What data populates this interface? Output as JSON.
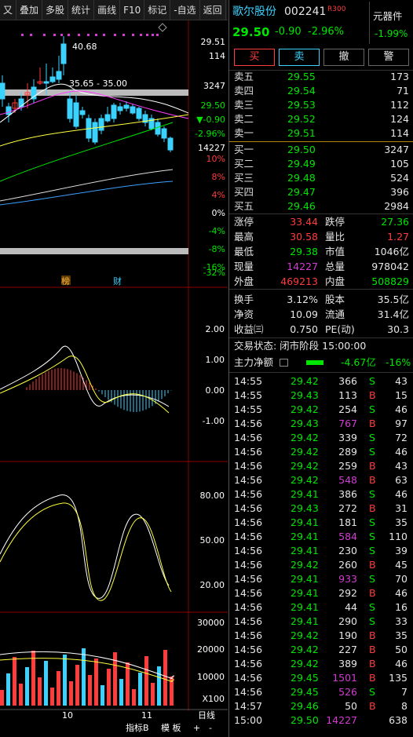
{
  "toolbar": {
    "items": [
      "又",
      "叠加",
      "多股",
      "统计",
      "画线",
      "F10",
      "标记",
      "-自选",
      "返回"
    ]
  },
  "stock": {
    "name": "歌尔股份",
    "code": "002241",
    "tag": "R300",
    "price": "29.50",
    "change": "-0.90",
    "change_pct": "-2.96%",
    "sector_name": "元器件",
    "sector_pct": "-1.99%"
  },
  "actions": {
    "buy": "买",
    "sell": "卖",
    "cancel": "撤",
    "alert": "警"
  },
  "asks": [
    {
      "label": "卖五",
      "price": "29.55",
      "vol": "173"
    },
    {
      "label": "卖四",
      "price": "29.54",
      "vol": "71"
    },
    {
      "label": "卖三",
      "price": "29.53",
      "vol": "112"
    },
    {
      "label": "卖二",
      "price": "29.52",
      "vol": "124"
    },
    {
      "label": "卖一",
      "price": "29.51",
      "vol": "114"
    }
  ],
  "bids": [
    {
      "label": "买一",
      "price": "29.50",
      "vol": "3247"
    },
    {
      "label": "买二",
      "price": "29.49",
      "vol": "105"
    },
    {
      "label": "买三",
      "price": "29.48",
      "vol": "524"
    },
    {
      "label": "买四",
      "price": "29.47",
      "vol": "396"
    },
    {
      "label": "买五",
      "price": "29.46",
      "vol": "2984"
    }
  ],
  "stats": {
    "limit_up_label": "涨停",
    "limit_up": "33.44",
    "limit_down_label": "跌停",
    "limit_down": "27.36",
    "high_label": "最高",
    "high": "30.58",
    "vol_ratio_label": "量比",
    "vol_ratio": "1.27",
    "low_label": "最低",
    "low": "29.38",
    "mcap_label": "市值",
    "mcap": "1046亿",
    "cur_vol_label": "现量",
    "cur_vol": "14227",
    "total_vol_label": "总量",
    "total_vol": "978042",
    "outer_label": "外盘",
    "outer": "469213",
    "inner_label": "内盘",
    "inner": "508829",
    "turnover_label": "换手",
    "turnover": "3.12%",
    "shares_label": "股本",
    "shares": "35.5亿",
    "nav_label": "净资",
    "nav": "10.09",
    "float_label": "流通",
    "float": "31.4亿",
    "eps_label": "收益㈢",
    "eps": "0.750",
    "pe_label": "PE(动)",
    "pe": "30.3"
  },
  "trade_status": "交易状态: 闭市阶段 15:00:00",
  "main_flow": {
    "label": "主力净额",
    "value": "-4.67亿",
    "pct": "-16%"
  },
  "ticks": [
    {
      "t": "14:55",
      "p": "29.42",
      "v": "366",
      "s": "S",
      "n": "43"
    },
    {
      "t": "14:55",
      "p": "29.43",
      "v": "113",
      "s": "B",
      "n": "15"
    },
    {
      "t": "14:55",
      "p": "29.42",
      "v": "254",
      "s": "S",
      "n": "46"
    },
    {
      "t": "14:56",
      "p": "29.43",
      "v": "767",
      "s": "B",
      "n": "97"
    },
    {
      "t": "14:56",
      "p": "29.42",
      "v": "339",
      "s": "S",
      "n": "72"
    },
    {
      "t": "14:56",
      "p": "29.42",
      "v": "289",
      "s": "S",
      "n": "46"
    },
    {
      "t": "14:56",
      "p": "29.42",
      "v": "259",
      "s": "B",
      "n": "43"
    },
    {
      "t": "14:56",
      "p": "29.42",
      "v": "548",
      "s": "B",
      "n": "63"
    },
    {
      "t": "14:56",
      "p": "29.41",
      "v": "386",
      "s": "S",
      "n": "46"
    },
    {
      "t": "14:56",
      "p": "29.43",
      "v": "272",
      "s": "B",
      "n": "31"
    },
    {
      "t": "14:56",
      "p": "29.41",
      "v": "181",
      "s": "S",
      "n": "35"
    },
    {
      "t": "14:56",
      "p": "29.41",
      "v": "584",
      "s": "S",
      "n": "110"
    },
    {
      "t": "14:56",
      "p": "29.41",
      "v": "230",
      "s": "S",
      "n": "39"
    },
    {
      "t": "14:56",
      "p": "29.42",
      "v": "260",
      "s": "B",
      "n": "45"
    },
    {
      "t": "14:56",
      "p": "29.41",
      "v": "933",
      "s": "S",
      "n": "70"
    },
    {
      "t": "14:56",
      "p": "29.41",
      "v": "292",
      "s": "B",
      "n": "46"
    },
    {
      "t": "14:56",
      "p": "29.41",
      "v": "44",
      "s": "S",
      "n": "16"
    },
    {
      "t": "14:56",
      "p": "29.41",
      "v": "290",
      "s": "S",
      "n": "33"
    },
    {
      "t": "14:56",
      "p": "29.42",
      "v": "190",
      "s": "B",
      "n": "35"
    },
    {
      "t": "14:56",
      "p": "29.42",
      "v": "227",
      "s": "B",
      "n": "50"
    },
    {
      "t": "14:56",
      "p": "29.42",
      "v": "389",
      "s": "B",
      "n": "46"
    },
    {
      "t": "14:56",
      "p": "29.45",
      "v": "1501",
      "s": "B",
      "n": "135"
    },
    {
      "t": "14:56",
      "p": "29.45",
      "v": "526",
      "s": "S",
      "n": "7"
    },
    {
      "t": "14:57",
      "p": "29.46",
      "v": "50",
      "s": "B",
      "n": "8"
    },
    {
      "t": "15:00",
      "p": "29.50",
      "v": "14227",
      "s": "",
      "n": "638"
    }
  ],
  "chart": {
    "price_axis": [
      "29.51",
      "114",
      "3247",
      "29.50",
      "▼-0.90",
      "-2.96%",
      "14227",
      "10%",
      "8%",
      "4%",
      "0%",
      "-4%",
      "-8%",
      "-16%",
      "-24%",
      "-32%"
    ],
    "high_annot": "40.68",
    "range_annot": "35.65 - 35.00",
    "markers": [
      "榜",
      "财"
    ],
    "macd_axis": [
      "2.00",
      "1.00",
      "0.00",
      "-1.00"
    ],
    "kdj_axis": [
      "80.00",
      "50.00",
      "20.00"
    ],
    "vol_axis": [
      "30000",
      "20000",
      "10000"
    ],
    "vol_unit": "X100",
    "x_labels": [
      "10",
      "11"
    ],
    "bottom_buttons": [
      "指标B",
      "模 板",
      "+",
      "-",
      "日线"
    ]
  },
  "colors": {
    "up": "#ff3c3c",
    "down": "#00e600",
    "bg": "#000000",
    "accent": "#3cd2ff"
  }
}
